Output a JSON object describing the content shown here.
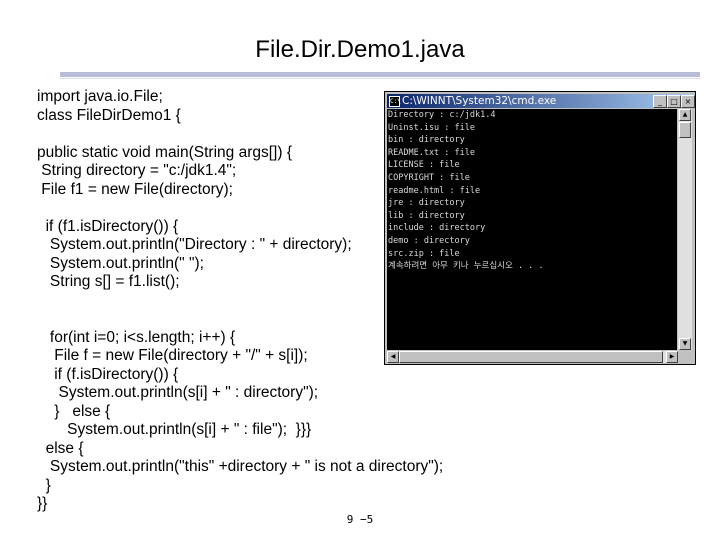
{
  "slide": {
    "title": "File.Dir.Demo1.java",
    "footer": "9 −5"
  },
  "code_lines": [
    "import java.io.File;",
    "class FileDirDemo1 {",
    "",
    "public static void main(String args[]) {",
    " String directory = \"c:/jdk1.4\";",
    " File f1 = new File(directory);",
    "",
    "  if (f1.isDirectory()) {",
    "   System.out.println(\"Directory : \" + directory);",
    "   System.out.println(\" \");",
    "   String s[] = f1.list();",
    "",
    "",
    "   for(int i=0; i<s.length; i++) {",
    "    File f = new File(directory + \"/\" + s[i]);",
    "    if (f.isDirectory()) {",
    "     System.out.println(s[i] + \" : directory\");",
    "    }   else {",
    "       System.out.println(s[i] + \" : file\");  }}}",
    "  else {",
    "   System.out.println(\"this\" +directory + \" is not a directory\");",
    "  }",
    "}}"
  ],
  "console": {
    "title": "C:\\WINNT\\System32\\cmd.exe",
    "icon_text": "C:\\",
    "buttons": {
      "minimize": "_",
      "maximize": "□",
      "close": "×"
    },
    "lines": [
      "Directory : c:/jdk1.4",
      "",
      "Uninst.isu : file",
      "bin : directory",
      "README.txt : file",
      "LICENSE : file",
      "COPYRIGHT : file",
      "readme.html : file",
      "jre : directory",
      "lib : directory",
      "include : directory",
      "demo : directory",
      "src.zip : file",
      "계속하려면 아무 키나 누르십시오 . . ."
    ],
    "scroll_icons": {
      "up": "up-arrow-icon",
      "down": "down-arrow-icon",
      "left": "left-arrow-icon",
      "right": "right-arrow-icon"
    }
  }
}
